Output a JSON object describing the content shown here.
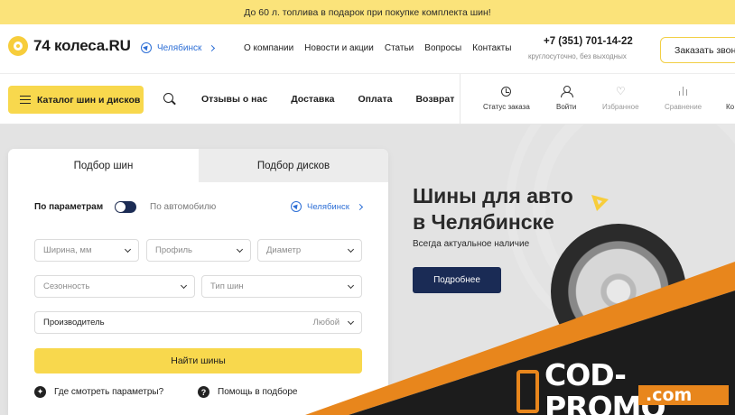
{
  "promo": {
    "text": "До 60 л. топлива в подарок при покупке комплекта шин!"
  },
  "header": {
    "logo_text": "74 колеса.RU",
    "city": "Челябинск",
    "nav": [
      "О компании",
      "Новости и акции",
      "Статьи",
      "Вопросы",
      "Контакты"
    ],
    "phone": "+7 (351) 701-14-22",
    "hours": "круглосуточно, без выходных",
    "callback_label": "Заказать звонок"
  },
  "toolbar": {
    "catalog_label": "Каталог шин и дисков",
    "nav": [
      "Отзывы о нас",
      "Доставка",
      "Оплата",
      "Возврат"
    ],
    "utilities": [
      {
        "label": "Статус заказа",
        "icon": "clock-icon"
      },
      {
        "label": "Войти",
        "icon": "user-icon"
      },
      {
        "label": "Избранное",
        "icon": "heart-icon"
      },
      {
        "label": "Сравнение",
        "icon": "compare-icon"
      },
      {
        "label": "Ко",
        "icon": "cart-icon"
      }
    ]
  },
  "form": {
    "tabs": [
      "Подбор шин",
      "Подбор дисков"
    ],
    "mode_params": "По параметрам",
    "mode_auto": "По автомобилю",
    "city": "Челябинск",
    "fields": {
      "width": "Ширина, мм",
      "profile": "Профиль",
      "diameter": "Диаметр",
      "season": "Сезонность",
      "tire_type": "Тип шин",
      "brand": "Производитель",
      "brand_value": "Любой"
    },
    "submit": "Найти шины",
    "help_params": "Где смотреть параметры?",
    "help_select": "Помощь в подборе"
  },
  "hero": {
    "title_line1": "Шины для авто",
    "title_line2": "в Челябинске",
    "subtitle": "Всегда актуальное наличие",
    "button": "Подробнее"
  },
  "watermark": {
    "main": "COD-PROMO",
    "sub": ".com"
  },
  "colors": {
    "accent_yellow": "#f8d84d",
    "navy": "#1a2b55",
    "link_blue": "#2d6fd6",
    "orange": "#e8861c"
  }
}
